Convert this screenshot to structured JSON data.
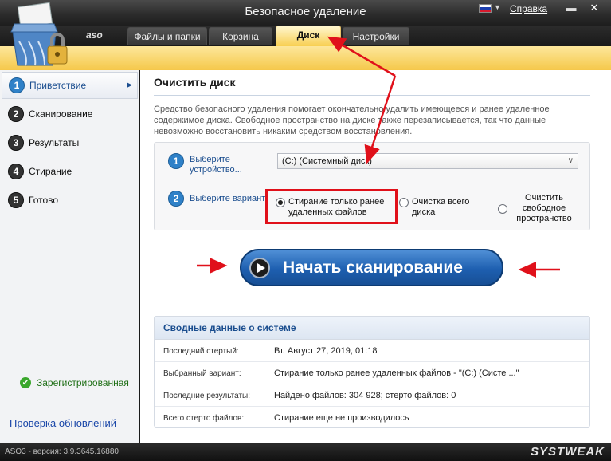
{
  "window": {
    "title": "Безопасное удаление",
    "help_label": "Справка",
    "minimize_glyph": "▬",
    "close_glyph": "✕",
    "language_flag_colors": [
      "#ffffff",
      "#1c3fb0",
      "#d6192c"
    ]
  },
  "brand": {
    "logo_text": "aso",
    "company": "SYSTWEAK"
  },
  "tabs": [
    {
      "label": "Файлы и папки",
      "active": false
    },
    {
      "label": "Корзина",
      "active": false
    },
    {
      "label": "Диск",
      "active": true
    },
    {
      "label": "Настройки",
      "active": false
    }
  ],
  "sidebar": {
    "steps": [
      {
        "number": "1",
        "label": "Приветствие",
        "active": true
      },
      {
        "number": "2",
        "label": "Сканирование",
        "active": false
      },
      {
        "number": "3",
        "label": "Результаты",
        "active": false
      },
      {
        "number": "4",
        "label": "Стирание",
        "active": false
      },
      {
        "number": "5",
        "label": "Готово",
        "active": false
      }
    ],
    "registered_label": "Зарегистрированная",
    "update_link": "Проверка обновлений"
  },
  "main": {
    "title": "Очистить диск",
    "description": "Средство безопасного удаления помогает окончательно удалить имеющееся и ранее удаленное содержимое диска. Свободное пространство на диске также перезаписывается, так что данные невозможно восстановить никаким средством восстановления.",
    "device": {
      "number": "1",
      "label": "Выберите устройство...",
      "selected": "(C:)  (Системный диск)"
    },
    "variant": {
      "number": "2",
      "label": "Выберите вариант:",
      "options": [
        {
          "label": "Стирание только ранее удаленных файлов",
          "checked": true
        },
        {
          "label": "Очистка всего диска",
          "checked": false
        },
        {
          "label": "Очистить свободное пространство",
          "checked": false
        }
      ]
    },
    "scan_button": "Начать сканирование",
    "summary": {
      "title": "Сводные данные о системе",
      "rows": [
        {
          "key": "Последний стертый:",
          "value": "Вт. Август 27, 2019, 01:18"
        },
        {
          "key": "Выбранный вариант:",
          "value": "Стирание только ранее удаленных файлов - \"(C:)  (Систе ...\""
        },
        {
          "key": "Последние результаты:",
          "value": "Найдено файлов: 304 928; стерто файлов: 0"
        },
        {
          "key": "Всего стерто файлов:",
          "value": "Стирание еще не производилось"
        }
      ]
    }
  },
  "status": {
    "version": "ASO3 - версия: 3.9.3645.16880"
  },
  "colors": {
    "accent": "#2f81c8",
    "active_tab": "#f8cf52",
    "annotation": "#e0101a"
  }
}
